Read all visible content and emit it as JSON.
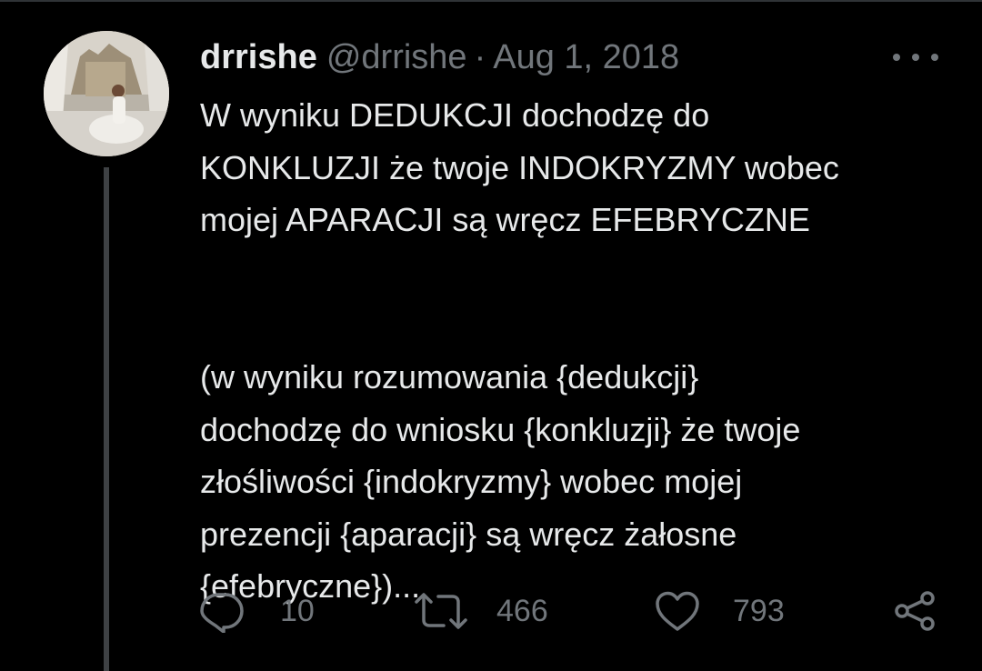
{
  "tweet": {
    "author_name": "drrishe",
    "author_handle": "@drrishe",
    "separator": "·",
    "date": "Aug 1, 2018",
    "text_lines": [
      "W wyniku DEDUKCJI dochodzę do",
      "KONKLUZJI że twoje INDOKRYZMY wobec",
      "mojej APARACJI są wręcz EFEBRYCZNE",
      "(w wyniku rozumowania {dedukcji}",
      "dochodzę do wniosku {konkluzji} że twoje",
      "złośliwości {indokryzmy} wobec mojej",
      "prezencji {aparacji} są wręcz żałosne",
      "{efebryczne})..."
    ]
  },
  "actions": {
    "reply_count": "10",
    "retweet_count": "466",
    "like_count": "793"
  },
  "icons": {
    "more": "more-icon",
    "reply": "reply-icon",
    "retweet": "retweet-icon",
    "like": "like-icon",
    "share": "share-icon"
  },
  "colors": {
    "background": "#000000",
    "text_primary": "#e7e9ea",
    "text_secondary": "#71767b",
    "thread_line": "#3e4144"
  }
}
